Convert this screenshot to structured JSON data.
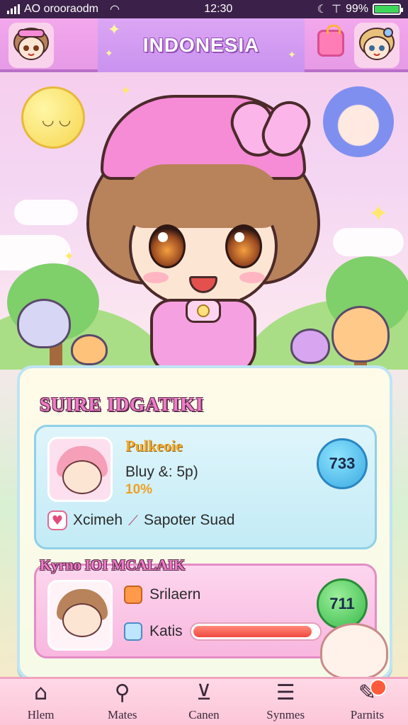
{
  "status_bar": {
    "carrier": "AO orooraodm",
    "time": "12:30",
    "battery": "99%",
    "battery_level": 0.99
  },
  "header": {
    "title": "INDONESIA"
  },
  "panel": {
    "title": "SUIRE IDGATIKI",
    "card1": {
      "name": "Pulkeoie",
      "stat": "Bluy &: 5p)",
      "percent": "10%",
      "score": "733",
      "footer_left": "Xcimeh",
      "footer_right": "Sapoter Suad"
    },
    "section_title": "Kyrno IOI MCALAIK",
    "card2": {
      "row1": "Srilaern",
      "row2": "Katis",
      "progress": 0.95,
      "score": "711"
    }
  },
  "nav": {
    "items": [
      {
        "label": "Hlem",
        "icon": "home-icon",
        "glyph": "⌂"
      },
      {
        "label": "Mates",
        "icon": "search-icon",
        "glyph": "⚲"
      },
      {
        "label": "Canen",
        "icon": "chevron-circle-icon",
        "glyph": "⊻"
      },
      {
        "label": "Synmes",
        "icon": "list-icon",
        "glyph": "☰"
      },
      {
        "label": "Parnits",
        "icon": "brush-icon",
        "glyph": "✎"
      }
    ]
  },
  "colors": {
    "accent_pink": "#f07cc8",
    "score_blue": "#3aa9e0",
    "score_green": "#36b84a",
    "progress_red": "#f0483e"
  }
}
